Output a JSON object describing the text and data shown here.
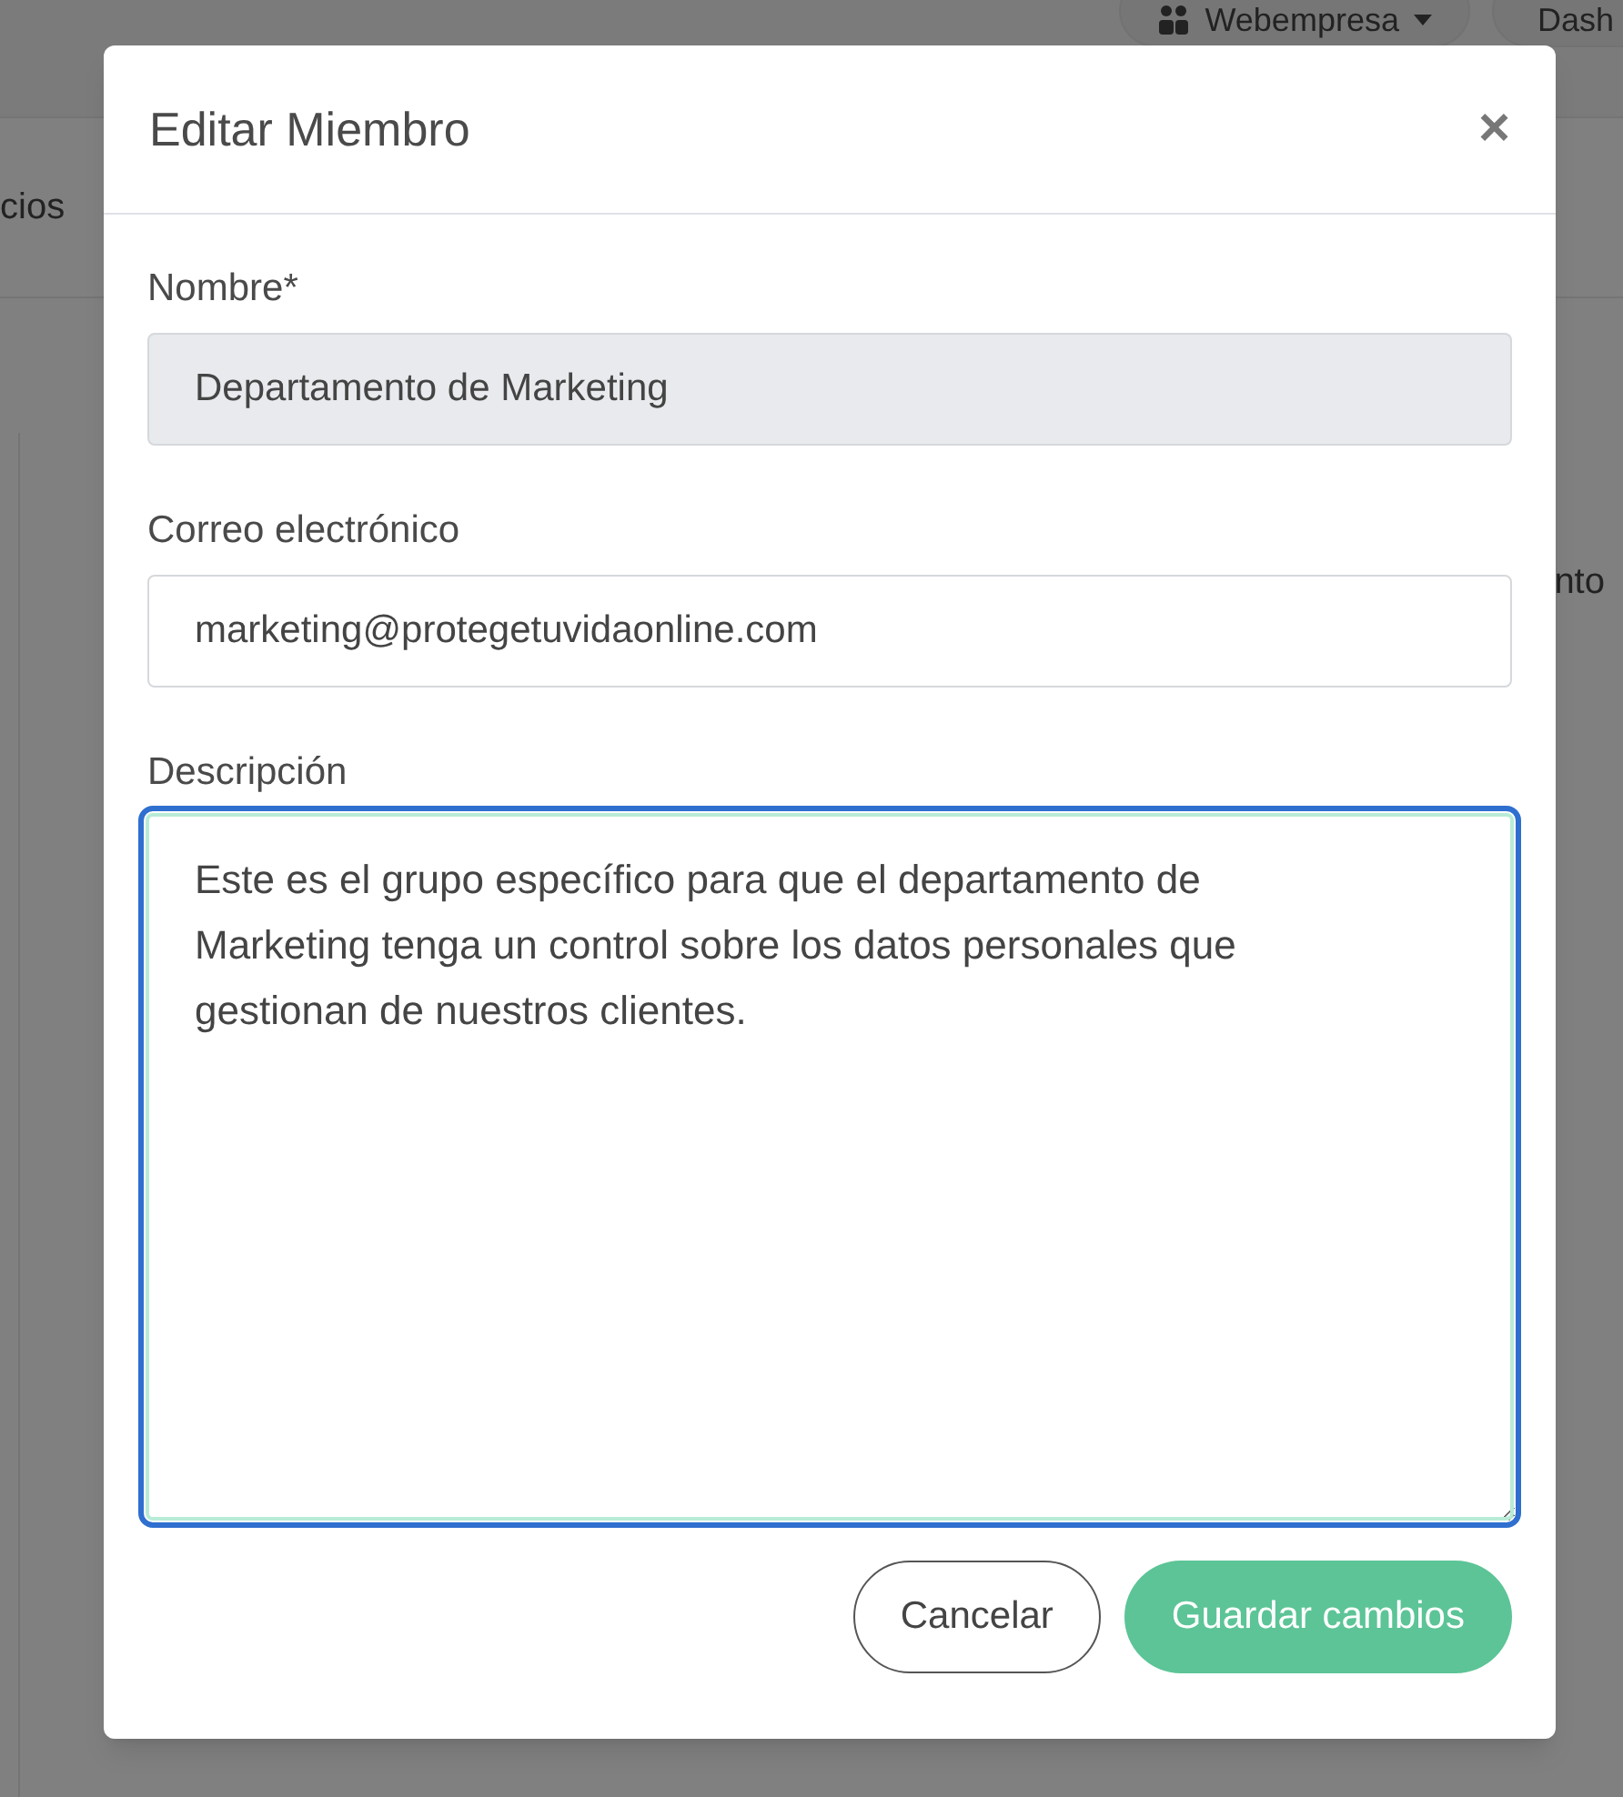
{
  "background": {
    "account_menu": "Webempresa",
    "nav_button": "Dash",
    "left_text": "cios",
    "right_text": "nto"
  },
  "dialog": {
    "title": "Editar Miembro",
    "close": "×",
    "fields": [
      {
        "kind": "input",
        "label": "Nombre*",
        "value": "Departamento de Marketing",
        "disabled": true
      },
      {
        "kind": "input",
        "label": "Correo electrónico",
        "value": "marketing@protegetuvidaonline.com",
        "disabled": false
      },
      {
        "kind": "textarea",
        "label": "Descripción",
        "value": "Este es el grupo específico para que el departamento de Marketing tenga un control sobre los datos personales que gestionan de nuestros clientes."
      }
    ],
    "buttons": [
      {
        "kind": "secondary",
        "label": "Cancelar"
      },
      {
        "kind": "primary",
        "label": "Guardar cambios"
      }
    ]
  }
}
